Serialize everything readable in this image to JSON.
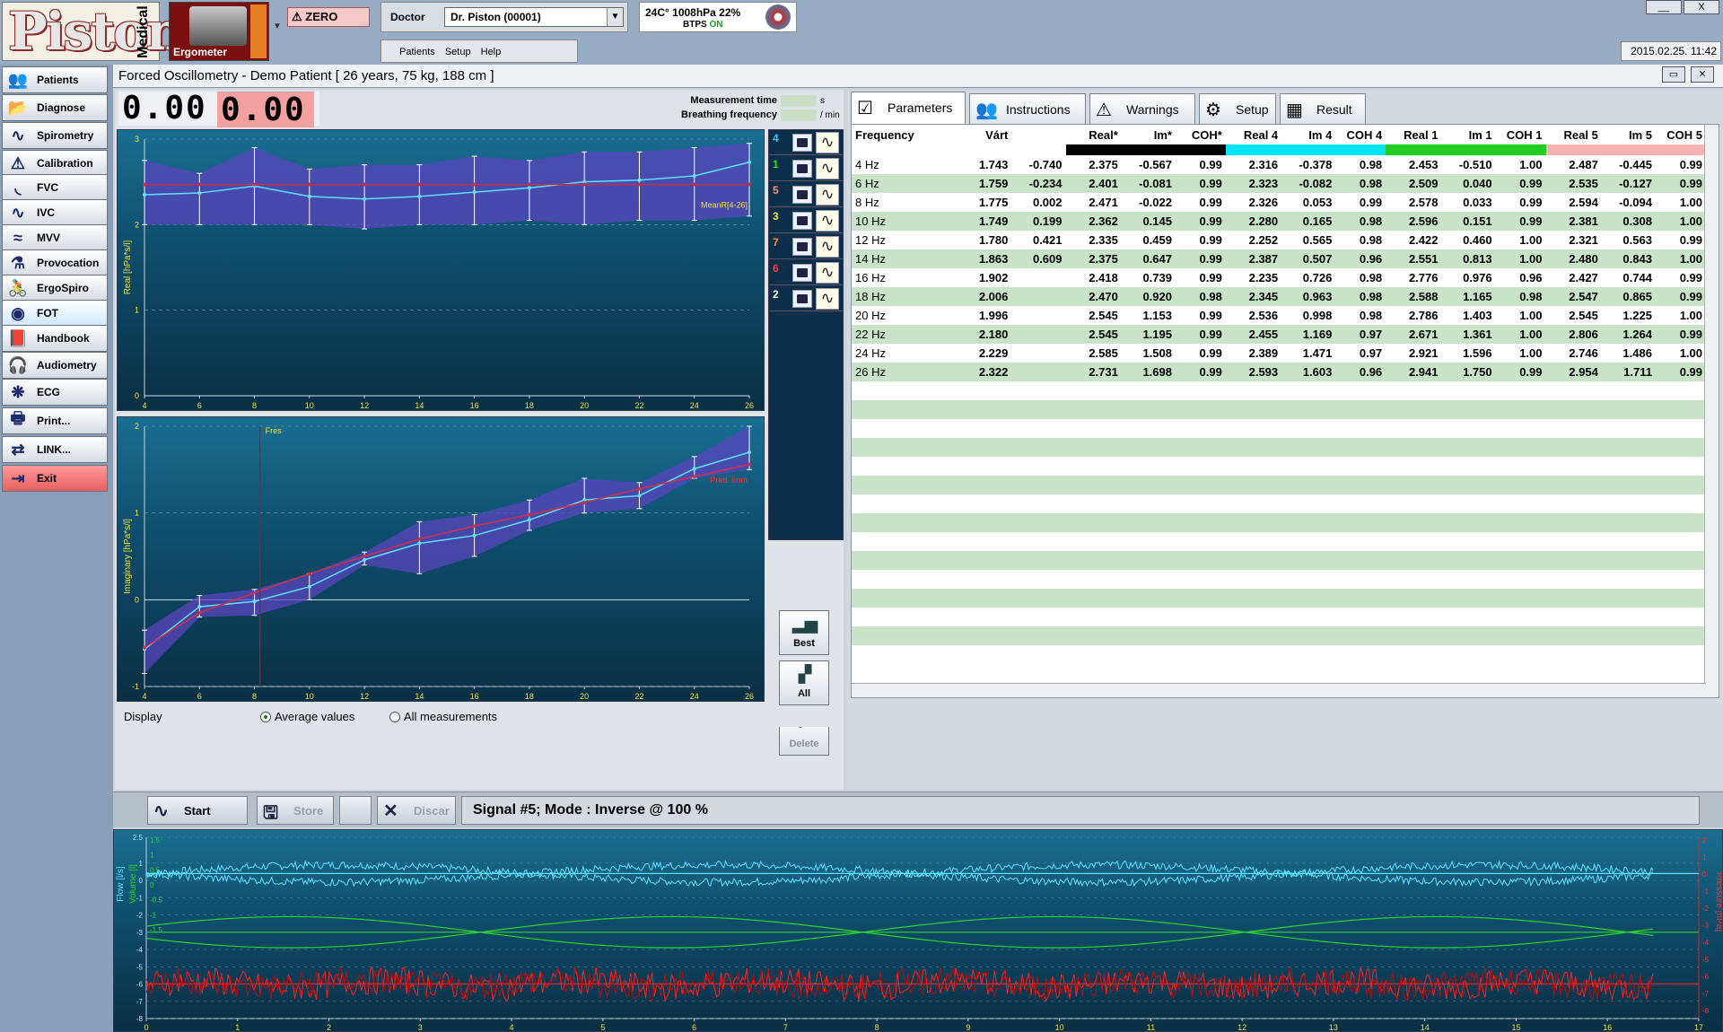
{
  "app": {
    "logo_text": "Piston",
    "logo_side": "Medical",
    "device_label": "Ergometer",
    "zero_label": "ZERO",
    "doctor_label": "Doctor",
    "doctor_value": "Dr. Piston (00001)",
    "menu": [
      "Patients",
      "Setup",
      "Help"
    ],
    "env_line1": "24C°  1008hPa  22%",
    "env_btps": "BTPS",
    "env_on": "ON",
    "datetime": "2015.02.25. 11:42",
    "minimize": "__",
    "close": "X"
  },
  "sidebar": {
    "items": [
      {
        "label": "Patients",
        "icon": "patients-icon",
        "glyph": "👥"
      },
      {
        "label": "Diagnose",
        "icon": "diagnose-icon",
        "glyph": "📂"
      },
      {
        "label": "Spirometry",
        "icon": "spirometry-icon",
        "glyph": "∿"
      },
      {
        "label": "Calibration",
        "icon": "calibration-warning-icon",
        "glyph": "⚠"
      },
      {
        "label": "FVC",
        "icon": "fvc-icon",
        "glyph": "◟"
      },
      {
        "label": "IVC",
        "icon": "ivc-icon",
        "glyph": "∿"
      },
      {
        "label": "MVV",
        "icon": "mvv-icon",
        "glyph": "≈"
      },
      {
        "label": "Provocation",
        "icon": "provocation-icon",
        "glyph": "⚗"
      },
      {
        "label": "ErgoSpiro",
        "icon": "ergospiro-icon",
        "glyph": "🚴"
      },
      {
        "label": "FOT",
        "icon": "fot-icon",
        "glyph": "◉"
      },
      {
        "label": "Handbook",
        "icon": "handbook-icon",
        "glyph": "📕"
      },
      {
        "label": "Audiometry",
        "icon": "audiometry-icon",
        "glyph": "🎧"
      },
      {
        "label": "ECG",
        "icon": "ecg-icon",
        "glyph": "❋"
      },
      {
        "label": "Print...",
        "icon": "print-icon",
        "glyph": "🖶"
      },
      {
        "label": "LINK...",
        "icon": "link-icon",
        "glyph": "⇄"
      },
      {
        "label": "Exit",
        "icon": "exit-icon",
        "glyph": "⇥"
      }
    ]
  },
  "window": {
    "title": "Forced Oscillometry  -  Demo Patient  [ 26 years, 75 kg, 188 cm ]"
  },
  "readouts": {
    "digits_left": "0.00",
    "digits_right": "0.00",
    "measurement_time_label": "Measurement time",
    "measurement_time_unit": "s",
    "breathing_freq_label": "Breathing frequency",
    "breathing_freq_unit": "/ min"
  },
  "signals": [
    {
      "num": "4",
      "color": "#35c8ff"
    },
    {
      "num": "1",
      "color": "#3ad43a"
    },
    {
      "num": "5",
      "color": "#ff8a8a"
    },
    {
      "num": "3",
      "color": "#f2e23a"
    },
    {
      "num": "7",
      "color": "#ff8a3a"
    },
    {
      "num": "6",
      "color": "#ff3a3a"
    },
    {
      "num": "2",
      "color": "#ffffff"
    }
  ],
  "actions": {
    "best": "Best",
    "all": "All",
    "delete": "Delete"
  },
  "display": {
    "label": "Display",
    "opt_avg": "Average values",
    "opt_all": "All measurements"
  },
  "tabs": [
    "Parameters",
    "Instructions",
    "Warnings",
    "Setup",
    "Result"
  ],
  "table": {
    "headers": [
      "Frequency",
      "Várt",
      "",
      "Real*",
      "Im*",
      "COH*",
      "Real 4",
      "Im 4",
      "COH 4",
      "Real 1",
      "Im 1",
      "COH 1",
      "Real 5",
      "Im 5",
      "COH 5"
    ],
    "series_colors": {
      "avg": "#000000",
      "s4": "#00e5ff",
      "s1": "#22cc22",
      "s5": "#ffb0b0"
    },
    "rows": [
      [
        "4 Hz",
        "1.743",
        "-0.740",
        "2.375",
        "-0.567",
        "0.99",
        "2.316",
        "-0.378",
        "0.98",
        "2.453",
        "-0.510",
        "1.00",
        "2.487",
        "-0.445",
        "0.99"
      ],
      [
        "6 Hz",
        "1.759",
        "-0.234",
        "2.401",
        "-0.081",
        "0.99",
        "2.323",
        "-0.082",
        "0.98",
        "2.509",
        "0.040",
        "0.99",
        "2.535",
        "-0.127",
        "0.99"
      ],
      [
        "8 Hz",
        "1.775",
        "0.002",
        "2.471",
        "-0.022",
        "0.99",
        "2.326",
        "0.053",
        "0.99",
        "2.578",
        "0.033",
        "0.99",
        "2.594",
        "-0.094",
        "1.00"
      ],
      [
        "10 Hz",
        "1.749",
        "0.199",
        "2.362",
        "0.145",
        "0.99",
        "2.280",
        "0.165",
        "0.98",
        "2.596",
        "0.151",
        "0.99",
        "2.381",
        "0.308",
        "1.00"
      ],
      [
        "12 Hz",
        "1.780",
        "0.421",
        "2.335",
        "0.459",
        "0.99",
        "2.252",
        "0.565",
        "0.98",
        "2.422",
        "0.460",
        "1.00",
        "2.321",
        "0.563",
        "0.99"
      ],
      [
        "14 Hz",
        "1.863",
        "0.609",
        "2.375",
        "0.647",
        "0.99",
        "2.387",
        "0.507",
        "0.96",
        "2.551",
        "0.813",
        "1.00",
        "2.480",
        "0.843",
        "1.00"
      ],
      [
        "16 Hz",
        "1.902",
        "",
        "2.418",
        "0.739",
        "0.99",
        "2.235",
        "0.726",
        "0.98",
        "2.776",
        "0.976",
        "0.96",
        "2.427",
        "0.744",
        "0.99"
      ],
      [
        "18 Hz",
        "2.006",
        "",
        "2.470",
        "0.920",
        "0.98",
        "2.345",
        "0.963",
        "0.98",
        "2.588",
        "1.165",
        "0.98",
        "2.547",
        "0.865",
        "0.99"
      ],
      [
        "20 Hz",
        "1.996",
        "",
        "2.545",
        "1.153",
        "0.99",
        "2.536",
        "0.998",
        "0.98",
        "2.786",
        "1.403",
        "1.00",
        "2.545",
        "1.225",
        "1.00"
      ],
      [
        "22 Hz",
        "2.180",
        "",
        "2.545",
        "1.195",
        "0.99",
        "2.455",
        "1.169",
        "0.97",
        "2.671",
        "1.361",
        "1.00",
        "2.806",
        "1.264",
        "0.99"
      ],
      [
        "24 Hz",
        "2.229",
        "",
        "2.585",
        "1.508",
        "0.99",
        "2.389",
        "1.471",
        "0.97",
        "2.921",
        "1.596",
        "1.00",
        "2.746",
        "1.486",
        "1.00"
      ],
      [
        "26 Hz",
        "2.322",
        "",
        "2.731",
        "1.698",
        "0.99",
        "2.593",
        "1.603",
        "0.96",
        "2.941",
        "1.750",
        "0.99",
        "2.954",
        "1.711",
        "0.99"
      ]
    ]
  },
  "toolbar": {
    "start": "Start",
    "store": "Store",
    "discard": "Discar",
    "status": "Signal #5;  Mode :  Inverse  @ 100 %"
  },
  "chart_data": [
    {
      "type": "line",
      "ylabel": "Real [hPa*s/l]",
      "ylim": [
        0,
        3
      ],
      "x": [
        4,
        6,
        8,
        10,
        12,
        14,
        16,
        18,
        20,
        22,
        24,
        26
      ],
      "xticks": [
        "4",
        "6",
        "8",
        "10",
        "12",
        "14",
        "16",
        "18",
        "20",
        "22",
        "24",
        "26"
      ],
      "yticks": [
        "0",
        "1",
        "2",
        "3"
      ],
      "annotation": "MeanR[4-26]",
      "series": [
        {
          "values": [
            2.35,
            2.37,
            2.45,
            2.33,
            2.3,
            2.33,
            2.38,
            2.43,
            2.5,
            2.52,
            2.57,
            2.73
          ],
          "color": "#5fe1ff"
        },
        {
          "values": [
            2.47,
            2.47,
            2.47,
            2.47,
            2.47,
            2.47,
            2.47,
            2.47,
            2.47,
            2.47,
            2.47,
            2.47
          ],
          "color": "#c0304a"
        }
      ],
      "band_upper": [
        2.75,
        2.6,
        2.9,
        2.65,
        2.7,
        2.7,
        2.8,
        2.75,
        2.85,
        2.85,
        2.9,
        2.95
      ],
      "band_lower": [
        2.0,
        2.0,
        2.0,
        2.0,
        1.95,
        2.0,
        2.0,
        2.05,
        2.0,
        2.05,
        2.05,
        2.1
      ]
    },
    {
      "type": "line",
      "ylabel": "Imaginary [hPa*s/l]",
      "ylim": [
        -1,
        2
      ],
      "x": [
        4,
        6,
        8,
        10,
        12,
        14,
        16,
        18,
        20,
        22,
        24,
        26
      ],
      "xticks": [
        "4",
        "6",
        "8",
        "10",
        "12",
        "14",
        "16",
        "18",
        "20",
        "22",
        "24",
        "26"
      ],
      "yticks": [
        "-1",
        "0",
        "1",
        "2"
      ],
      "annotation": "Fres",
      "annotation2": "Pred. Imm",
      "fres_x": 8.2,
      "series": [
        {
          "values": [
            -0.57,
            -0.08,
            -0.02,
            0.15,
            0.46,
            0.65,
            0.74,
            0.92,
            1.15,
            1.2,
            1.51,
            1.7
          ],
          "color": "#5fe1ff"
        },
        {
          "values": [
            -0.55,
            -0.15,
            0.08,
            0.3,
            0.5,
            0.7,
            0.85,
            0.98,
            1.12,
            1.28,
            1.42,
            1.56
          ],
          "color": "#d0304a"
        }
      ],
      "band_upper": [
        -0.35,
        0.05,
        0.12,
        0.3,
        0.55,
        0.9,
        0.98,
        1.15,
        1.4,
        1.35,
        1.65,
        2.0
      ],
      "band_lower": [
        -0.85,
        -0.2,
        -0.18,
        0.0,
        0.4,
        0.3,
        0.5,
        0.8,
        1.0,
        1.05,
        1.4,
        1.5
      ]
    },
    {
      "type": "line",
      "xlim": [
        0,
        17
      ],
      "xticks": [
        "0",
        "1",
        "2",
        "3",
        "4",
        "5",
        "6",
        "7",
        "8",
        "9",
        "10",
        "11",
        "12",
        "13",
        "14",
        "15",
        "16",
        "17"
      ],
      "ylabel_left1": "Flow [l/s]",
      "ylabel_left2": "Volume [l]",
      "ylabel_right": "Pressure [hPa]",
      "yticks_left": [
        "2.5",
        "1",
        "0",
        "-1",
        "-2",
        "-3",
        "-4",
        "-5",
        "-6",
        "-7",
        "-8"
      ],
      "yticks_mid": [
        "1.5",
        "1",
        "0.5",
        "0",
        "-0.5",
        "-1",
        "-1.5"
      ],
      "yticks_right": [
        "2",
        "1",
        "0",
        "-1",
        "-2",
        "-3",
        "-4",
        "-5",
        "-6",
        "-7",
        "-8"
      ],
      "series": [
        {
          "color": "#5fe1ff",
          "amplitude": 0.45,
          "level": 0.4
        },
        {
          "color": "#2bd42b",
          "amplitude": 0.55,
          "level": -3.0
        },
        {
          "color": "#ff2020",
          "amplitude": 0.6,
          "level": -6.0
        }
      ]
    }
  ]
}
